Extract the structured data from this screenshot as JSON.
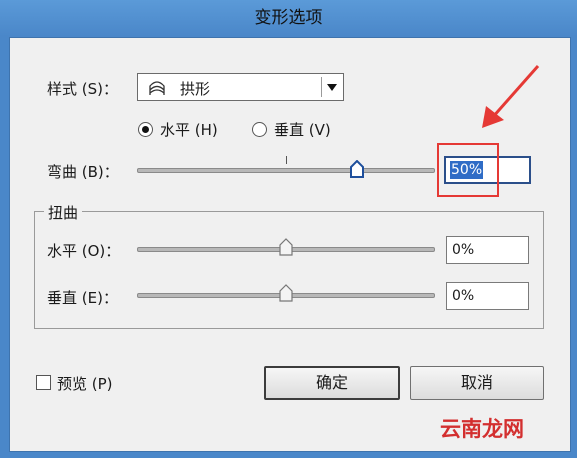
{
  "window": {
    "title": "变形选项"
  },
  "style_row": {
    "label": "样式 (S)：",
    "value": "拱形",
    "icon": "arch-icon"
  },
  "orientation": {
    "horizontal_label": "水平 (H)",
    "vertical_label": "垂直 (V)",
    "selected": "horizontal"
  },
  "bend": {
    "label": "弯曲 (B)：",
    "value": "50%",
    "level": 0.5
  },
  "distortion": {
    "group_title": "扭曲",
    "horizontal": {
      "label": "水平 (O)：",
      "value": "0%",
      "level": 0.0
    },
    "vertical": {
      "label": "垂直 (E)：",
      "value": "0%",
      "level": 0.0
    }
  },
  "preview": {
    "label": "预览 (P)",
    "checked": false
  },
  "buttons": {
    "ok": "确定",
    "cancel": "取消"
  },
  "watermark": "云南龙网",
  "colors": {
    "titlebar": "#4a87c9",
    "selection": "#2f6cc6",
    "annotation": "#e53935"
  }
}
